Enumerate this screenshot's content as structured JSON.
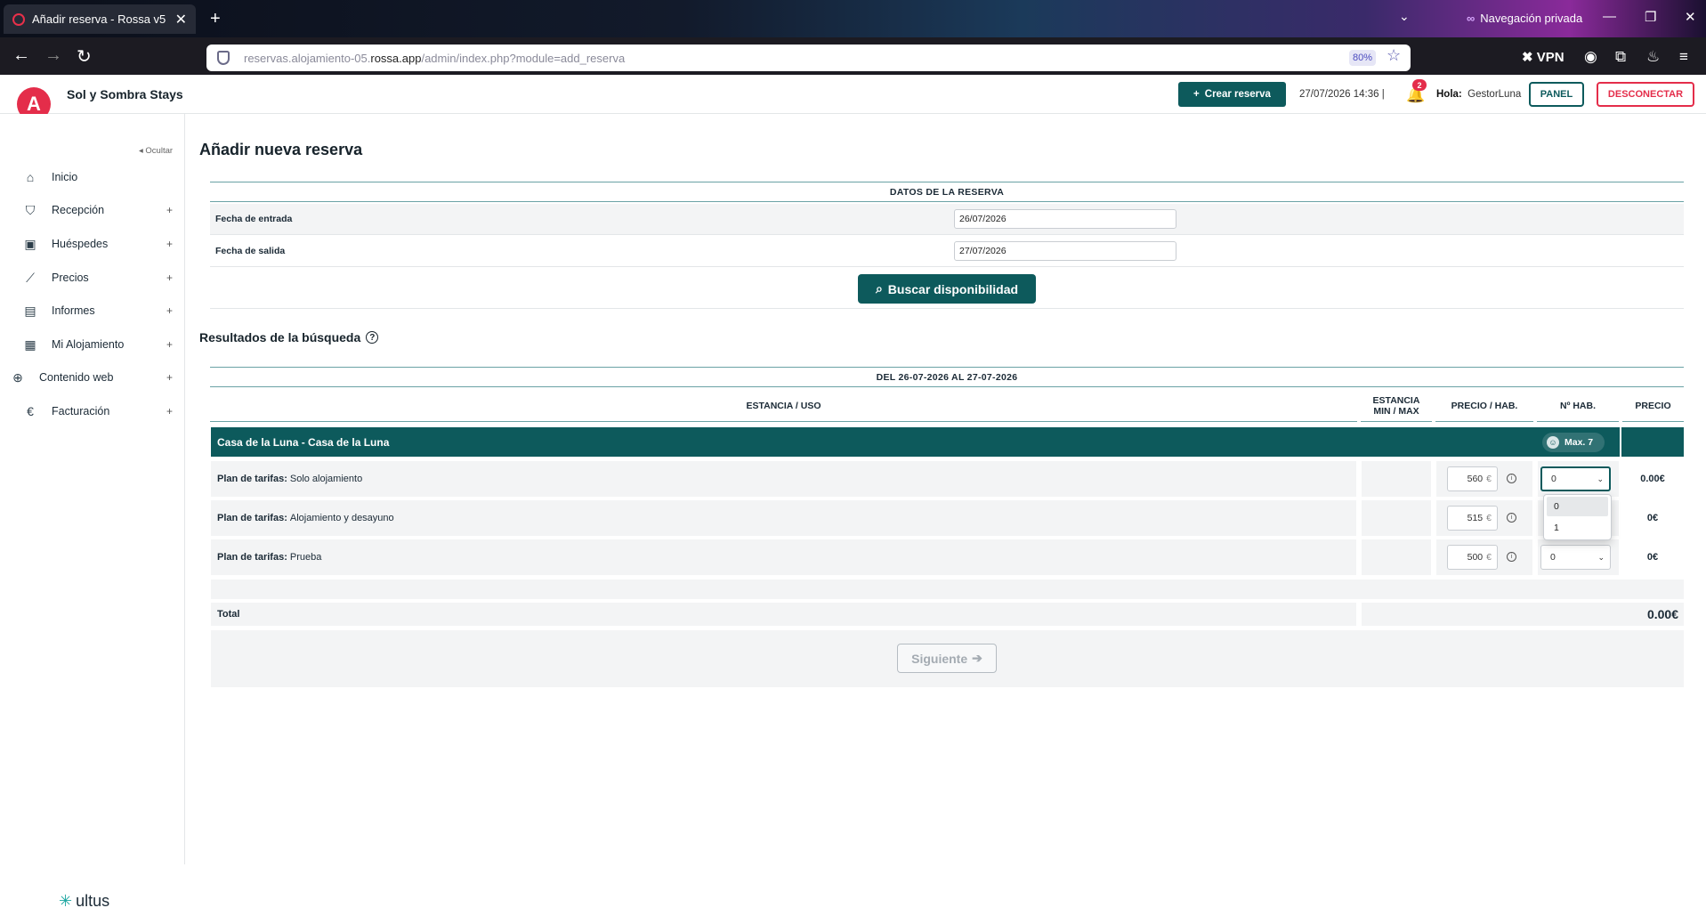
{
  "browser": {
    "tab_title": "Añadir reserva - Rossa v5",
    "private_label": "Navegación privada",
    "url_prefix": "reservas.alojamiento-05.",
    "url_host": "rossa.app",
    "url_path": "/admin/index.php?module=add_reserva",
    "zoom": "80%",
    "vpn_label": "VPN"
  },
  "header": {
    "brand": "Sol y Sombra Stays",
    "create_label": "Crear reserva",
    "datetime": "27/07/2026 14:36 |",
    "notifications": "2",
    "hello_label": "Hola:",
    "user": "GestorLuna",
    "panel_label": "PANEL",
    "logout_label": "DESCONECTAR"
  },
  "sidebar": {
    "hide_label": "Ocultar",
    "items": [
      {
        "label": "Inicio",
        "icon": "home-icon"
      },
      {
        "label": "Recepción",
        "icon": "bell-desk-icon"
      },
      {
        "label": "Huéspedes",
        "icon": "luggage-icon"
      },
      {
        "label": "Precios",
        "icon": "chart-icon"
      },
      {
        "label": "Informes",
        "icon": "report-icon"
      },
      {
        "label": "Mi Alojamiento",
        "icon": "building-icon"
      },
      {
        "label": "Contenido web",
        "icon": "globe-icon"
      },
      {
        "label": "Facturación",
        "icon": "invoice-icon"
      }
    ],
    "footer_brand": "ultus"
  },
  "main": {
    "title": "Añadir nueva reserva",
    "booking_section": "DATOS DE LA RESERVA",
    "checkin_label": "Fecha de entrada",
    "checkin_value": "26/07/2026",
    "checkout_label": "Fecha de salida",
    "checkout_value": "27/07/2026",
    "search_button": "Buscar disponibilidad",
    "results_title": "Resultados de la búsqueda",
    "range_title": "DEL 26-07-2026 AL 27-07-2026",
    "columns": {
      "stay": "ESTANCIA / USO",
      "minmax_1": "ESTANCIA",
      "minmax_2": "MIN / MAX",
      "price_room": "PRECIO / HAB.",
      "rooms": "Nº HAB.",
      "price": "PRECIO"
    },
    "room": {
      "name": "Casa de la Luna - Casa de la Luna",
      "capacity": "Max. 7"
    },
    "plan_label": "Plan de tarifas:",
    "plans": [
      {
        "name": "Solo alojamiento",
        "price": "560",
        "rooms": "0",
        "total": "0.00€"
      },
      {
        "name": "Alojamiento y desayuno",
        "price": "515",
        "rooms": "",
        "total": "0€"
      },
      {
        "name": "Prueba",
        "price": "500",
        "rooms": "0",
        "total": "0€"
      }
    ],
    "currency": "€",
    "dropdown_options": [
      "0",
      "1"
    ],
    "total_label": "Total",
    "total_value": "0.00€",
    "next_button": "Siguiente"
  }
}
